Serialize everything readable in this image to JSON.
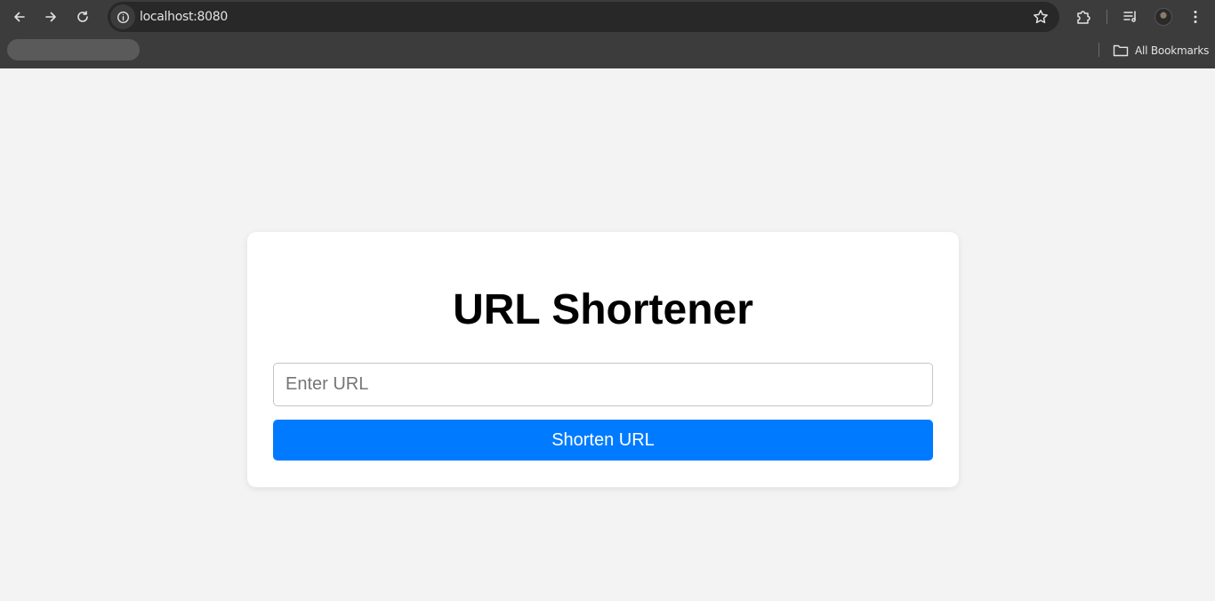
{
  "browser": {
    "url": "localhost:8080",
    "bookmarks_bar": {
      "all_bookmarks_label": "All Bookmarks"
    },
    "icons": {
      "back": "back-arrow-icon",
      "forward": "forward-arrow-icon",
      "reload": "reload-icon",
      "site_info": "info-icon",
      "bookmark_star": "star-icon",
      "extensions": "puzzle-icon",
      "media": "media-queue-icon",
      "menu": "kebab-menu-icon",
      "folder": "folder-icon"
    },
    "colors": {
      "chrome_bg": "#3c3c3c",
      "omnibox_bg": "#282828"
    }
  },
  "page": {
    "title": "URL Shortener",
    "input": {
      "placeholder": "Enter URL",
      "value": ""
    },
    "button_label": "Shorten URL",
    "colors": {
      "background": "#f3f3f3",
      "card": "#ffffff",
      "accent": "#007bff"
    }
  }
}
